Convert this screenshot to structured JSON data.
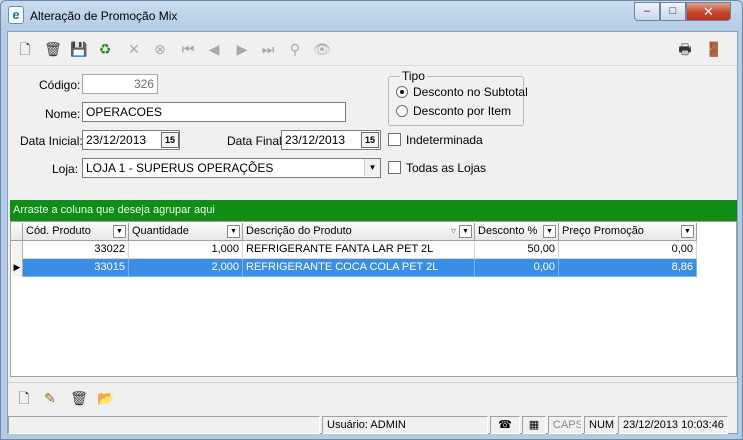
{
  "window": {
    "title": "Alteração de Promoção Mix",
    "app_icon": "e-icon",
    "controls": {
      "minimize": "‒",
      "maximize": "□",
      "close": "✕"
    }
  },
  "toolbar": {
    "left": [
      {
        "name": "new-icon",
        "glyph": "🗋",
        "enabled": true
      },
      {
        "name": "delete-icon",
        "glyph": "🗑",
        "enabled": true
      },
      {
        "name": "save-icon",
        "glyph": "💾",
        "enabled": false
      },
      {
        "name": "refresh-icon",
        "glyph": "♻",
        "enabled": true
      },
      {
        "name": "cancel-icon",
        "glyph": "✕",
        "enabled": false
      },
      {
        "name": "search-record-icon",
        "glyph": "⊗",
        "enabled": false
      },
      {
        "name": "first-icon",
        "glyph": "⏮",
        "enabled": false
      },
      {
        "name": "previous-icon",
        "glyph": "◀",
        "enabled": false
      },
      {
        "name": "next-icon",
        "glyph": "▶",
        "enabled": false
      },
      {
        "name": "last-icon",
        "glyph": "⏭",
        "enabled": false
      },
      {
        "name": "filter-icon",
        "glyph": "⚲",
        "enabled": false
      },
      {
        "name": "binoculars-icon",
        "glyph": "👁",
        "enabled": false
      }
    ],
    "right": [
      {
        "name": "print-icon",
        "glyph": "🖶"
      },
      {
        "name": "exit-icon",
        "glyph": "🚪"
      }
    ]
  },
  "form": {
    "codigo": {
      "label": "Código:",
      "value": "326"
    },
    "nome": {
      "label": "Nome:",
      "value": "OPERACOES"
    },
    "data_inicial": {
      "label": "Data Inicial:",
      "value": "23/12/2013",
      "cal": "15"
    },
    "data_final": {
      "label": "Data Final:",
      "value": "23/12/2013",
      "cal": "15"
    },
    "loja": {
      "label": "Loja:",
      "value": "LOJA 1 - SUPERUS OPERAÇÕES"
    },
    "indeterminada": {
      "label": "Indeterminada",
      "checked": false
    },
    "todas_lojas": {
      "label": "Todas as Lojas",
      "checked": false
    },
    "tipo": {
      "title": "Tipo",
      "options": [
        "Desconto no Subtotal",
        "Desconto por Item"
      ],
      "selected": "Desconto no Subtotal"
    }
  },
  "grid": {
    "group_hint": "Arraste a coluna que deseja agrupar aqui",
    "columns": [
      "Cód. Produto",
      "Quantidade",
      "Descrição do Produto",
      "Desconto %",
      "Preço Promoção"
    ],
    "rows": [
      [
        "33022",
        "1,000",
        "REFRIGERANTE FANTA LAR PET 2L",
        "50,00",
        "0,00"
      ],
      [
        "33015",
        "2,000",
        "REFRIGERANTE COCA COLA PET 2L",
        "0,00",
        "8,86"
      ]
    ],
    "selected_row": 1,
    "selection_color": "#3a8ee6",
    "group_band_color": "#118c17"
  },
  "bottom_toolbar": [
    {
      "name": "add-item-icon",
      "glyph": "🗋"
    },
    {
      "name": "edit-item-icon",
      "glyph": "✎"
    },
    {
      "name": "delete-item-icon",
      "glyph": "🗑"
    },
    {
      "name": "open-folder-icon",
      "glyph": "📂"
    }
  ],
  "status": {
    "user": "Usuário: ADMIN",
    "phone_icon": "☎",
    "calc_icon": "▦",
    "caps": "CAPS",
    "num": "NUM",
    "datetime": "23/12/2013 10:03:46"
  }
}
